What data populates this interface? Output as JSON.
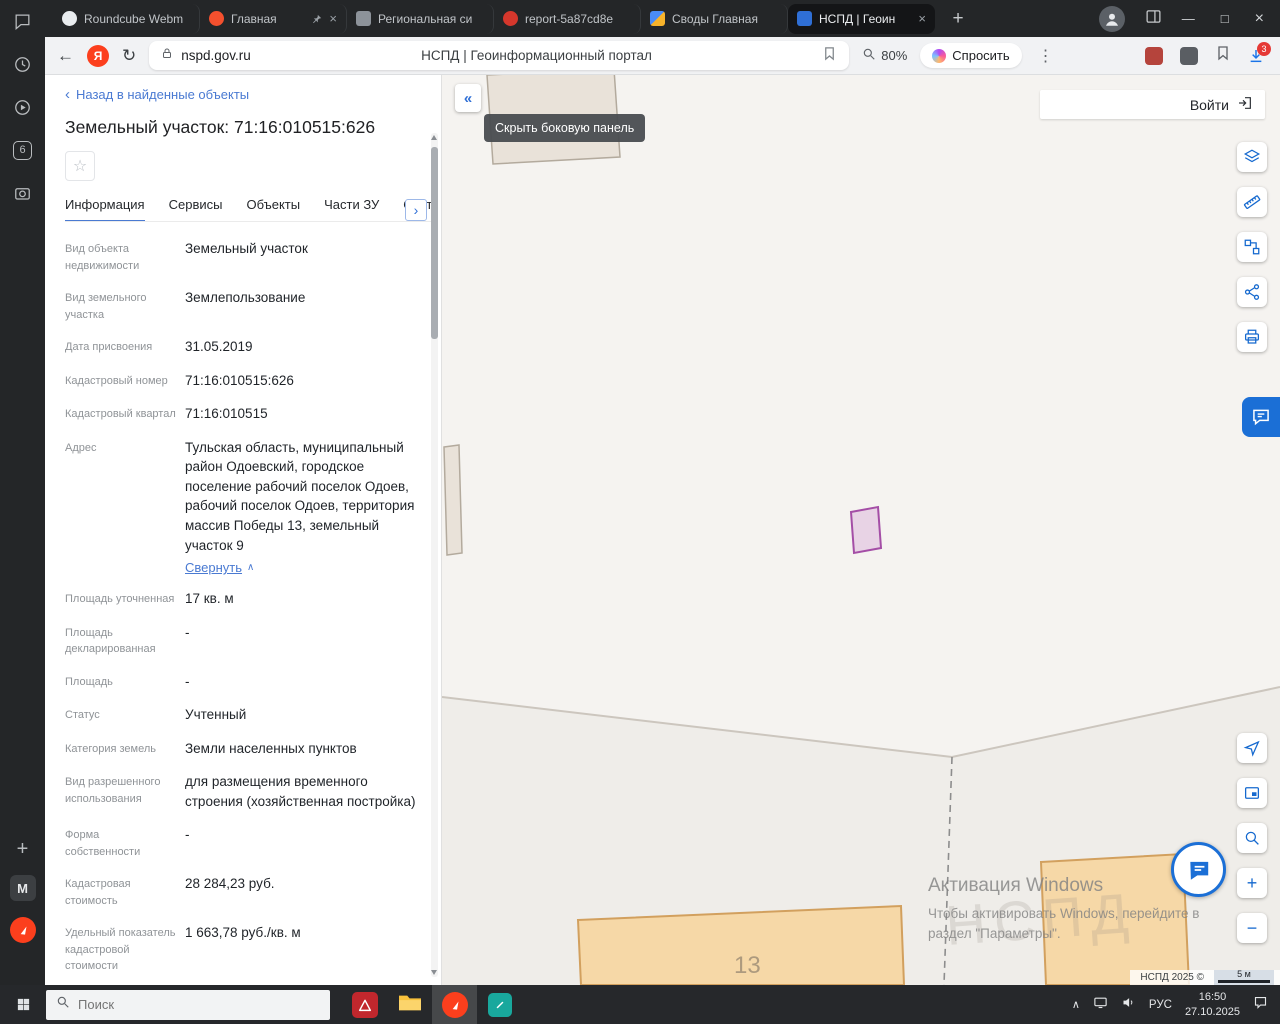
{
  "glyphs": {
    "back": "←",
    "reload": "↻",
    "menu_dots": "⋮",
    "new_tab": "+",
    "minimize": "—",
    "maximize": "□",
    "close": "×",
    "tab_close": "×",
    "yandex_letter": "Я",
    "star": "☆",
    "chevron_left": "‹",
    "chevron_up": "∧",
    "tab_overflow": "›",
    "hide_panel": "«",
    "zoom_in": "+",
    "zoom_out": "−",
    "sidebar_add": "+",
    "workspace_letter": "M",
    "tray_chevron": "∧"
  },
  "browser": {
    "tab_counter": "6",
    "tabs": [
      {
        "title": "Roundcube Webm",
        "icon": "roundcube"
      },
      {
        "title": "Главная",
        "icon": "glavnaya",
        "pinned": true,
        "close": true
      },
      {
        "title": "Региональная си",
        "icon": "regional"
      },
      {
        "title": "report-5a87cd8e",
        "icon": "report"
      },
      {
        "title": "Своды Главная",
        "icon": "svody"
      },
      {
        "title": "НСПД | Геоин",
        "icon": "nspd",
        "active": true,
        "close": true
      }
    ]
  },
  "toolbar": {
    "url": "nspd.gov.ru",
    "page_title": "НСПД | Геоинформационный портал",
    "zoom_level": "80%",
    "ask_label": "Спросить",
    "downloads_badge": "3"
  },
  "panel": {
    "back_link": "Назад в найденные объекты",
    "title": "Земельный участок: 71:16:010515:626",
    "tabs": [
      {
        "label": "Информация",
        "active": true
      },
      {
        "label": "Сервисы"
      },
      {
        "label": "Объекты"
      },
      {
        "label": "Части ЗУ"
      },
      {
        "label": "Сост"
      }
    ],
    "details": [
      {
        "label": "Вид объекта недвижимости",
        "value": "Земельный участок"
      },
      {
        "label": "Вид земельного участка",
        "value": "Землепользование"
      },
      {
        "label": "Дата присвоения",
        "value": "31.05.2019"
      },
      {
        "label": "Кадастровый номер",
        "value": "71:16:010515:626"
      },
      {
        "label": "Кадастровый квартал",
        "value": "71:16:010515"
      },
      {
        "label": "Адрес",
        "value": "Тульская область, муниципальный район Одоевский, городское поселение рабочий поселок Одоев, рабочий поселок Одоев, территория массив Победы 13, земельный участок 9",
        "collapse_link": "Свернуть"
      },
      {
        "label": "Площадь уточненная",
        "value": "17 кв. м"
      },
      {
        "label": "Площадь декларированная",
        "value": "-"
      },
      {
        "label": "Площадь",
        "value": "-"
      },
      {
        "label": "Статус",
        "value": "Учтенный"
      },
      {
        "label": "Категория земель",
        "value": "Земли населенных пунктов"
      },
      {
        "label": "Вид разрешенного использования",
        "value": "для размещения временного строения (хозяйственная постройка)"
      },
      {
        "label": "Форма собственности",
        "value": "-"
      },
      {
        "label": "Кадастровая стоимость",
        "value": "28 284,23 руб."
      },
      {
        "label": "Удельный показатель кадастровой стоимости",
        "value": "1 663,78 руб./кв. м"
      }
    ]
  },
  "map": {
    "tooltip": "Скрыть боковую панель",
    "login_label": "Войти",
    "parcel_label": "13",
    "ghost_watermark": "НСПД",
    "watermark": {
      "line1": "Активация Windows",
      "line2": "Чтобы активировать Windows, перейдите в",
      "line3": "раздел \"Параметры\"."
    },
    "attribution": "НСПД 2025 ©",
    "scale_label": "5 м",
    "colors": {
      "parcel_fill": "rgba(197,130,201,0.28)",
      "parcel_stroke": "#a44ea6",
      "building_fill": "#f6d8a7",
      "building_stroke": "#d2a05e",
      "accent_blue": "#1569cf"
    }
  },
  "taskbar": {
    "search_placeholder": "Поиск",
    "language": "РУС",
    "time": "16:50",
    "date": "27.10.2025"
  }
}
